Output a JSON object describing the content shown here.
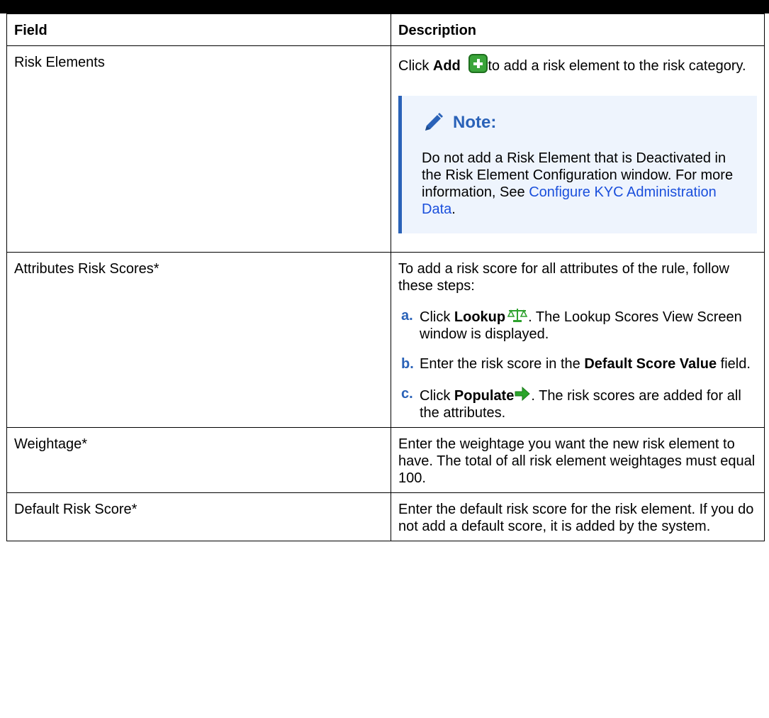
{
  "table": {
    "header": {
      "field": "Field",
      "description": "Description"
    },
    "rows": {
      "risk_elements": {
        "field": "Risk Elements",
        "desc_pre": "Click ",
        "desc_bold": "Add",
        "desc_post": "to add a risk element to the risk category.",
        "icon": "add-icon",
        "note": {
          "title": "Note:",
          "body_pre": "Do not add a Risk Element that is Deactivated in the Risk Element Configuration window. For more information, See ",
          "link": "Configure KYC Administration Data",
          "body_post": "."
        }
      },
      "attributes": {
        "field": "Attributes Risk Scores*",
        "intro": "To add a risk score for all attributes of the rule, follow these steps:",
        "steps": [
          {
            "marker": "a.",
            "pre": "Click ",
            "bold": "Lookup",
            "post": ". The Lookup Scores View Screen window is displayed.",
            "icon": "scale-icon"
          },
          {
            "marker": "b.",
            "pre": "Enter the risk score in the ",
            "bold": "Default Score Value",
            "post": " field."
          },
          {
            "marker": "c.",
            "pre": "Click ",
            "bold": "Populate",
            "post": ". The risk scores are added for all the attributes.",
            "icon": "arrow-right-icon"
          }
        ]
      },
      "weightage": {
        "field": "Weightage*",
        "desc": "Enter the weightage you want the new risk element to have. The total of all risk element weightages must equal 100."
      },
      "default_score": {
        "field": "Default Risk Score*",
        "desc": "Enter the default risk score for the risk element. If you do not add a default score, it is added by the system."
      }
    }
  },
  "colors": {
    "accent": "#2a62b8",
    "link": "#1a4fdc",
    "note_bg": "#eef4fd",
    "icon_green": "#3aa53a"
  }
}
